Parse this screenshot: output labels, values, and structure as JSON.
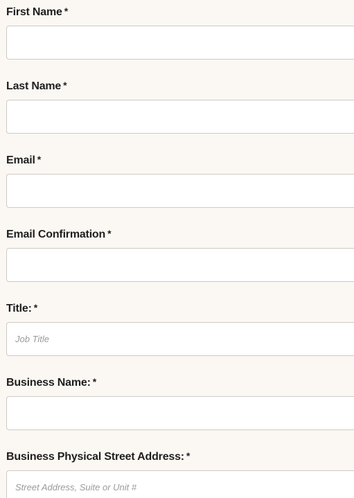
{
  "form": {
    "fields": [
      {
        "label": "First Name",
        "required_mark": "*",
        "value": "",
        "placeholder": ""
      },
      {
        "label": "Last Name",
        "required_mark": "*",
        "value": "",
        "placeholder": ""
      },
      {
        "label": "Email",
        "required_mark": "*",
        "value": "",
        "placeholder": ""
      },
      {
        "label": "Email Confirmation",
        "required_mark": "*",
        "value": "",
        "placeholder": ""
      },
      {
        "label": "Title:",
        "required_mark": "*",
        "value": "",
        "placeholder": "Job Title"
      },
      {
        "label": "Business Name:",
        "required_mark": "*",
        "value": "",
        "placeholder": ""
      },
      {
        "label": "Business Physical Street Address:",
        "required_mark": "*",
        "value": "",
        "placeholder": "Street Address, Suite or Unit #"
      }
    ]
  }
}
